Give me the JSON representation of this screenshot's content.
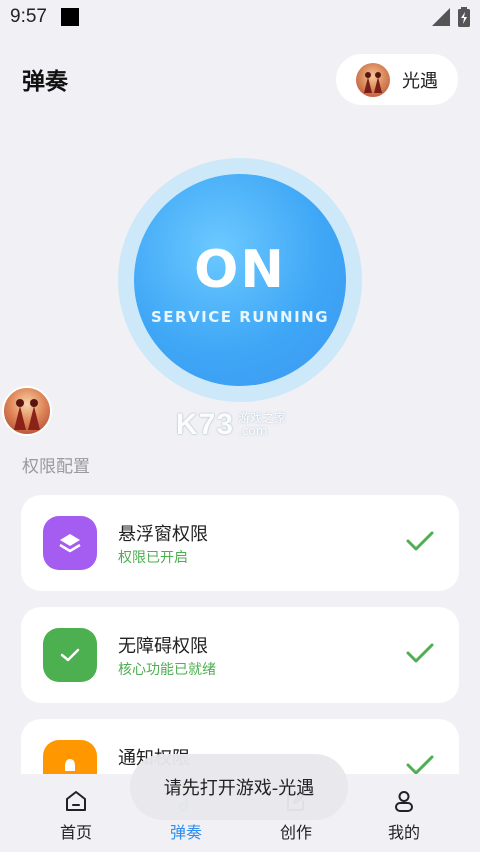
{
  "status_bar": {
    "time": "9:57"
  },
  "header": {
    "title": "弹奏",
    "game_chip_label": "光遇"
  },
  "service": {
    "state": "ON",
    "subtitle": "SERVICE RUNNING"
  },
  "watermark": {
    "brand": "K73",
    "text_line1": "游戏之家",
    "text_line2": ".com"
  },
  "permissions": {
    "section_label": "权限配置",
    "items": [
      {
        "title": "悬浮窗权限",
        "status": "权限已开启",
        "icon": "layers-icon",
        "color": "#a55cf1"
      },
      {
        "title": "无障碍权限",
        "status": "核心功能已就绪",
        "icon": "check-icon",
        "color": "#4caf50"
      },
      {
        "title": "通知权限",
        "status": "",
        "icon": "bell-icon",
        "color": "#ff9800"
      }
    ]
  },
  "toast": {
    "message": "请先打开游戏-光遇"
  },
  "bottom_nav": {
    "items": [
      {
        "label": "首页",
        "icon": "home-icon",
        "active": false
      },
      {
        "label": "弹奏",
        "icon": "music-note-icon",
        "active": true
      },
      {
        "label": "创作",
        "icon": "edit-icon",
        "active": false
      },
      {
        "label": "我的",
        "icon": "person-icon",
        "active": false
      }
    ]
  },
  "colors": {
    "accent": "#2f8ef0",
    "success": "#4caf50",
    "background": "#f1f0f5"
  }
}
